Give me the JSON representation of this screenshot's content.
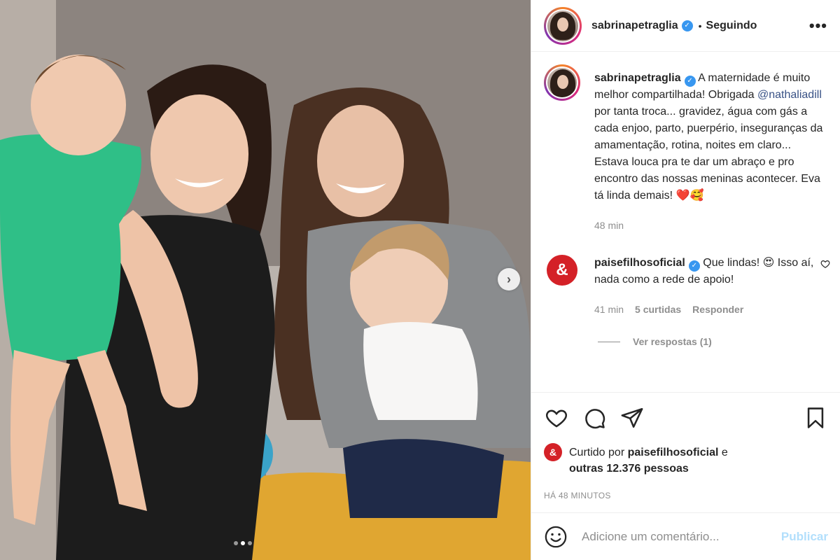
{
  "header": {
    "username": "sabrinapetraglia",
    "separator": "•",
    "follow_status": "Seguindo",
    "more": "•••"
  },
  "caption": {
    "username": "sabrinapetraglia",
    "text_before_mention": "A maternidade é muito melhor compartilhada! Obrigada ",
    "mention": "@nathaliadill",
    "text_after_mention": " por tanta troca... gravidez, água com gás a cada enjoo, parto, puerpério, inseguranças da amamentação, rotina, noites em claro... Estava louca pra te dar um abraço e pro encontro das nossas meninas acontecer. Eva tá linda demais! ",
    "emoji": "❤️🥰",
    "time": "48 min"
  },
  "comment": {
    "username": "paisefilhosoficial",
    "avatar_letter": "&",
    "text": "Que lindas! 😍 Isso aí, nada como a rede de apoio!",
    "time": "41 min",
    "likes": "5 curtidas",
    "reply": "Responder",
    "view_replies": "Ver respostas (1)"
  },
  "likes": {
    "avatar_letter": "&",
    "prefix": "Curtido por ",
    "user": "paisefilhosoficial",
    "middle": " e ",
    "others": "outras 12.376 pessoas"
  },
  "posted_time": "HÁ 48 MINUTOS",
  "add_comment": {
    "placeholder": "Adicione um comentário...",
    "post_label": "Publicar"
  },
  "carousel": {
    "next": "›",
    "total_slides": 3,
    "active_slide": 2
  },
  "colors": {
    "link": "#385185",
    "verified": "#3897f0",
    "brand_red": "#d42127",
    "muted": "#8e8e8e",
    "post_button": "#b2dffc"
  }
}
